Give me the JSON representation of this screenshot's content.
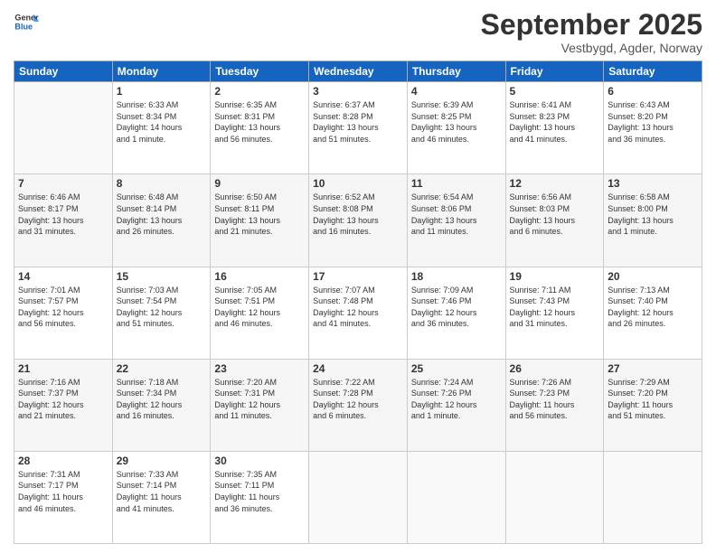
{
  "header": {
    "logo_line1": "General",
    "logo_line2": "Blue",
    "month": "September 2025",
    "location": "Vestbygd, Agder, Norway"
  },
  "weekdays": [
    "Sunday",
    "Monday",
    "Tuesday",
    "Wednesday",
    "Thursday",
    "Friday",
    "Saturday"
  ],
  "weeks": [
    [
      {
        "day": "",
        "info": ""
      },
      {
        "day": "1",
        "info": "Sunrise: 6:33 AM\nSunset: 8:34 PM\nDaylight: 14 hours\nand 1 minute."
      },
      {
        "day": "2",
        "info": "Sunrise: 6:35 AM\nSunset: 8:31 PM\nDaylight: 13 hours\nand 56 minutes."
      },
      {
        "day": "3",
        "info": "Sunrise: 6:37 AM\nSunset: 8:28 PM\nDaylight: 13 hours\nand 51 minutes."
      },
      {
        "day": "4",
        "info": "Sunrise: 6:39 AM\nSunset: 8:25 PM\nDaylight: 13 hours\nand 46 minutes."
      },
      {
        "day": "5",
        "info": "Sunrise: 6:41 AM\nSunset: 8:23 PM\nDaylight: 13 hours\nand 41 minutes."
      },
      {
        "day": "6",
        "info": "Sunrise: 6:43 AM\nSunset: 8:20 PM\nDaylight: 13 hours\nand 36 minutes."
      }
    ],
    [
      {
        "day": "7",
        "info": "Sunrise: 6:46 AM\nSunset: 8:17 PM\nDaylight: 13 hours\nand 31 minutes."
      },
      {
        "day": "8",
        "info": "Sunrise: 6:48 AM\nSunset: 8:14 PM\nDaylight: 13 hours\nand 26 minutes."
      },
      {
        "day": "9",
        "info": "Sunrise: 6:50 AM\nSunset: 8:11 PM\nDaylight: 13 hours\nand 21 minutes."
      },
      {
        "day": "10",
        "info": "Sunrise: 6:52 AM\nSunset: 8:08 PM\nDaylight: 13 hours\nand 16 minutes."
      },
      {
        "day": "11",
        "info": "Sunrise: 6:54 AM\nSunset: 8:06 PM\nDaylight: 13 hours\nand 11 minutes."
      },
      {
        "day": "12",
        "info": "Sunrise: 6:56 AM\nSunset: 8:03 PM\nDaylight: 13 hours\nand 6 minutes."
      },
      {
        "day": "13",
        "info": "Sunrise: 6:58 AM\nSunset: 8:00 PM\nDaylight: 13 hours\nand 1 minute."
      }
    ],
    [
      {
        "day": "14",
        "info": "Sunrise: 7:01 AM\nSunset: 7:57 PM\nDaylight: 12 hours\nand 56 minutes."
      },
      {
        "day": "15",
        "info": "Sunrise: 7:03 AM\nSunset: 7:54 PM\nDaylight: 12 hours\nand 51 minutes."
      },
      {
        "day": "16",
        "info": "Sunrise: 7:05 AM\nSunset: 7:51 PM\nDaylight: 12 hours\nand 46 minutes."
      },
      {
        "day": "17",
        "info": "Sunrise: 7:07 AM\nSunset: 7:48 PM\nDaylight: 12 hours\nand 41 minutes."
      },
      {
        "day": "18",
        "info": "Sunrise: 7:09 AM\nSunset: 7:46 PM\nDaylight: 12 hours\nand 36 minutes."
      },
      {
        "day": "19",
        "info": "Sunrise: 7:11 AM\nSunset: 7:43 PM\nDaylight: 12 hours\nand 31 minutes."
      },
      {
        "day": "20",
        "info": "Sunrise: 7:13 AM\nSunset: 7:40 PM\nDaylight: 12 hours\nand 26 minutes."
      }
    ],
    [
      {
        "day": "21",
        "info": "Sunrise: 7:16 AM\nSunset: 7:37 PM\nDaylight: 12 hours\nand 21 minutes."
      },
      {
        "day": "22",
        "info": "Sunrise: 7:18 AM\nSunset: 7:34 PM\nDaylight: 12 hours\nand 16 minutes."
      },
      {
        "day": "23",
        "info": "Sunrise: 7:20 AM\nSunset: 7:31 PM\nDaylight: 12 hours\nand 11 minutes."
      },
      {
        "day": "24",
        "info": "Sunrise: 7:22 AM\nSunset: 7:28 PM\nDaylight: 12 hours\nand 6 minutes."
      },
      {
        "day": "25",
        "info": "Sunrise: 7:24 AM\nSunset: 7:26 PM\nDaylight: 12 hours\nand 1 minute."
      },
      {
        "day": "26",
        "info": "Sunrise: 7:26 AM\nSunset: 7:23 PM\nDaylight: 11 hours\nand 56 minutes."
      },
      {
        "day": "27",
        "info": "Sunrise: 7:29 AM\nSunset: 7:20 PM\nDaylight: 11 hours\nand 51 minutes."
      }
    ],
    [
      {
        "day": "28",
        "info": "Sunrise: 7:31 AM\nSunset: 7:17 PM\nDaylight: 11 hours\nand 46 minutes."
      },
      {
        "day": "29",
        "info": "Sunrise: 7:33 AM\nSunset: 7:14 PM\nDaylight: 11 hours\nand 41 minutes."
      },
      {
        "day": "30",
        "info": "Sunrise: 7:35 AM\nSunset: 7:11 PM\nDaylight: 11 hours\nand 36 minutes."
      },
      {
        "day": "",
        "info": ""
      },
      {
        "day": "",
        "info": ""
      },
      {
        "day": "",
        "info": ""
      },
      {
        "day": "",
        "info": ""
      }
    ]
  ]
}
